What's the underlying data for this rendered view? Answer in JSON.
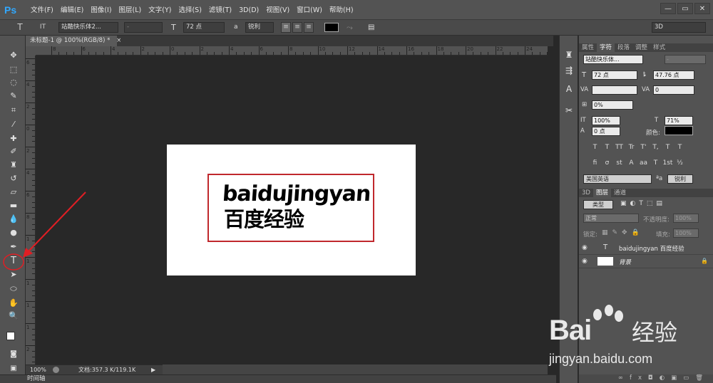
{
  "app": {
    "logo": "Ps"
  },
  "menu": [
    "文件(F)",
    "编辑(E)",
    "图像(I)",
    "图层(L)",
    "文字(Y)",
    "选择(S)",
    "滤镜(T)",
    "3D(D)",
    "视图(V)",
    "窗口(W)",
    "帮助(H)"
  ],
  "window_buttons": {
    "minimize": "—",
    "restore": "▭",
    "close": "✕"
  },
  "options": {
    "tool_icon": "T",
    "orient_icon": "IT",
    "font_family": "站酷快乐体2...",
    "font_style": "-",
    "size_icon": "T",
    "font_size": "72 点",
    "aa_icon": "a",
    "antialias": "锐利",
    "color": "#000000",
    "workspace": "3D"
  },
  "document": {
    "tab_title": "未标题-1 @ 100%(RGB/8) *",
    "close": "×",
    "text_line1": "baidujingyan",
    "text_line2": "百度经验"
  },
  "ruler_h": [
    "8",
    "6",
    "4",
    "2",
    "0",
    "2",
    "4",
    "6",
    "8",
    "10",
    "12",
    "14",
    "16",
    "18",
    "20",
    "22",
    "24"
  ],
  "ruler_v": [
    "6",
    "4",
    "2",
    "0",
    "2",
    "4",
    "6",
    "8",
    "1",
    "1",
    "1",
    "1",
    "1",
    "2"
  ],
  "status": {
    "zoom": "100%",
    "doc": "文档:357.3 K/119.1K",
    "arrow": "▶"
  },
  "timeline_label": "时间轴",
  "panel": {
    "tabs_top": [
      "属性",
      "字符",
      "段落",
      "调整",
      "样式"
    ],
    "char": {
      "font": "站酷快乐体...",
      "style": "-",
      "size": "72 点",
      "leading": "47.76 点",
      "kerning": "",
      "tracking": "0",
      "scale_pct": "0%",
      "vscale": "100%",
      "hscale": "71%",
      "baseline": "0 点",
      "color_label": "颜色:",
      "language": "美国英语",
      "aa": "锐利",
      "style_buttons": [
        "T",
        "T",
        "TT",
        "Tr",
        "T'",
        "T,",
        "T",
        "T"
      ],
      "ot_buttons": [
        "fi",
        "σ",
        "st",
        "A",
        "aa",
        "T",
        "1st",
        "½"
      ]
    },
    "layers_tabs": [
      "3D",
      "图层",
      "通道"
    ],
    "filter_kind": "类型",
    "blend_mode": "正常",
    "opacity_label": "不透明度:",
    "opacity": "100%",
    "lock_label": "锁定:",
    "fill_label": "填充:",
    "fill": "100%",
    "layers": [
      {
        "thumb": "T",
        "name": "baidujingyan 百度经验"
      },
      {
        "thumb": "",
        "name": "背景",
        "lock": "🔒"
      }
    ],
    "footer_icons": [
      "∞",
      "fx",
      "◘",
      "◐",
      "▣",
      "▭",
      "🗑"
    ]
  },
  "watermark": {
    "bai": "Bai",
    "jy": "经验",
    "url": "jingyan.baidu.com"
  }
}
